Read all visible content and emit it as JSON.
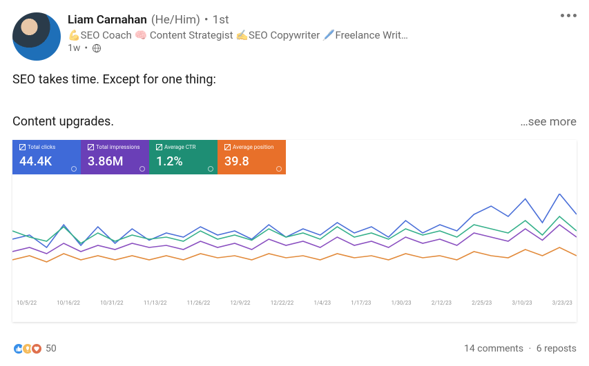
{
  "author": {
    "name": "Liam Carnahan",
    "pronoun": "(He/Him)",
    "degree": "1st",
    "headline": "💪SEO Coach 🧠 Content Strategist ✍️SEO Copywriter 🖊️Freelance Writ…",
    "age": "1w"
  },
  "post": {
    "line1": "SEO takes time. Except for one thing:",
    "line2": "Content upgrades.",
    "see_more": "…see more"
  },
  "metrics": {
    "clicks_label": "Total clicks",
    "clicks_value": "44.4K",
    "impressions_label": "Total impressions",
    "impressions_value": "3.86M",
    "ctr_label": "Average CTR",
    "ctr_value": "1.2%",
    "position_label": "Average position",
    "position_value": "39.8"
  },
  "chart_data": {
    "type": "line",
    "x_labels": [
      "10/5/22",
      "10/16/22",
      "10/31/22",
      "11/13/22",
      "11/26/22",
      "12/9/22",
      "12/22/22",
      "1/4/23",
      "1/17/23",
      "1/30/23",
      "2/12/23",
      "2/25/23",
      "3/10/23",
      "3/23/23"
    ],
    "series": [
      {
        "name": "Total clicks",
        "color": "#4a6fd8",
        "values": [
          56,
          60,
          48,
          70,
          50,
          68,
          52,
          66,
          55,
          62,
          58,
          68,
          60,
          64,
          56,
          70,
          58,
          66,
          60,
          72,
          62,
          68,
          58,
          74,
          62,
          70,
          64,
          80,
          88,
          78,
          95,
          72,
          100,
          80
        ]
      },
      {
        "name": "Average CTR",
        "color": "#35b08a",
        "values": [
          64,
          58,
          54,
          68,
          52,
          62,
          54,
          60,
          56,
          58,
          54,
          64,
          56,
          60,
          55,
          66,
          58,
          62,
          56,
          68,
          58,
          62,
          56,
          66,
          60,
          64,
          58,
          70,
          66,
          62,
          74,
          60,
          78,
          64
        ]
      },
      {
        "name": "Total impressions",
        "color": "#8a4fc0",
        "values": [
          44,
          48,
          42,
          52,
          44,
          50,
          46,
          52,
          48,
          50,
          46,
          54,
          48,
          52,
          46,
          56,
          50,
          54,
          48,
          58,
          50,
          54,
          48,
          58,
          52,
          56,
          50,
          62,
          58,
          54,
          66,
          55,
          70,
          58
        ]
      },
      {
        "name": "Average position",
        "color": "#e28a3a",
        "values": [
          36,
          40,
          34,
          42,
          36,
          40,
          36,
          40,
          36,
          40,
          36,
          42,
          38,
          40,
          36,
          42,
          38,
          40,
          36,
          42,
          38,
          40,
          36,
          42,
          38,
          40,
          36,
          44,
          40,
          38,
          46,
          40,
          48,
          40
        ]
      }
    ]
  },
  "social": {
    "reaction_count": "50",
    "comments": "14 comments",
    "reposts": "6 reposts"
  }
}
